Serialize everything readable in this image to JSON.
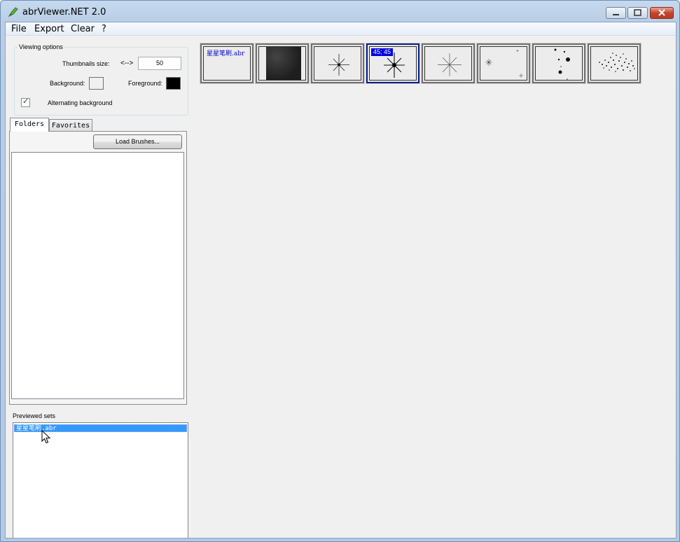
{
  "window": {
    "title": "abrViewer.NET 2.0"
  },
  "menu": [
    "File",
    "Export",
    "Clear",
    "?"
  ],
  "viewing_options": {
    "group_label": "Viewing options",
    "thumb_size_label": "Thumbnails size:",
    "arrow_label": "<-->",
    "thumb_size_value": "50",
    "background_label": "Background:",
    "foreground_label": "Foreground:",
    "background_color": "#f0f0f0",
    "foreground_color": "#000000",
    "alternating_label": "Alternating background",
    "alternating_checked": true
  },
  "tabs": [
    "Folders",
    "Favorites"
  ],
  "load_button": "Load Brushes...",
  "previewed": {
    "label": "Previewed sets",
    "items": [
      "星星笔刷.abr"
    ]
  },
  "thumbnails": [
    {
      "kind": "name",
      "text": "星星笔刷.abr"
    },
    {
      "kind": "texture"
    },
    {
      "kind": "star"
    },
    {
      "kind": "star-selected",
      "size": "45; 45"
    },
    {
      "kind": "star-soft"
    },
    {
      "kind": "sparkles"
    },
    {
      "kind": "dots"
    },
    {
      "kind": "scatter"
    }
  ]
}
